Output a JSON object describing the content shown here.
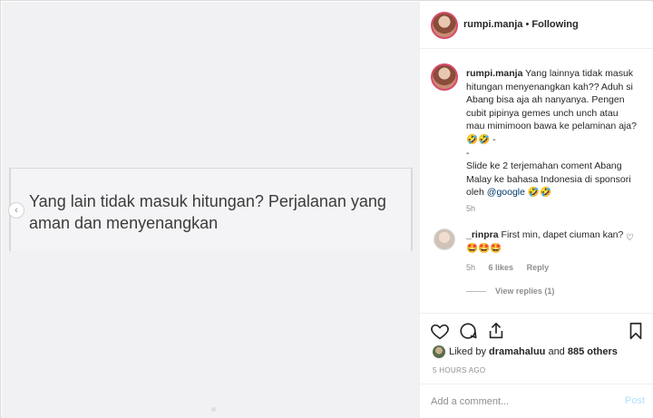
{
  "media": {
    "text": "Yang lain tidak masuk hitungan? Perjalanan yang aman dan menyenangkan",
    "prev_icon": "chevron-left-icon"
  },
  "header": {
    "username": "rumpi.manja",
    "separator": " • ",
    "follow_label": "Following"
  },
  "caption": {
    "username": "rumpi.manja",
    "text": "Yang lainnya tidak masuk hitungan menyenangkan kah?? Aduh si Abang bisa aja ah nanyanya. Pengen cubit pipinya gemes unch unch atau mau mimimoon bawa ke pelaminan aja? 🤣🤣 -\n-\nSlide ke 2 terjemahan coment Abang Malay ke bahasa Indonesia di sponsori oleh ",
    "mention": "@google",
    "text_end": " 🤣🤣",
    "time": "5h"
  },
  "comment": {
    "username": "_rinpra",
    "text": "First min, dapet ciuman kan?🤩🤩🤩",
    "time": "5h",
    "likes": "6 likes",
    "reply_label": "Reply",
    "view_replies": "View replies (1)"
  },
  "actions": {
    "icons": [
      "heart-icon",
      "comment-icon",
      "share-icon",
      "bookmark-icon"
    ],
    "liked_by_prefix": "Liked by ",
    "liked_by_user": "dramahaluu",
    "liked_by_and": " and ",
    "liked_by_others": "885 others",
    "time_ago": "5 HOURS AGO"
  },
  "add_comment": {
    "placeholder": "Add a comment...",
    "post_label": "Post"
  },
  "colors": {
    "accent": "#0095f6",
    "post_disabled": "#b2dffc",
    "story_ring": "#d84b6b"
  }
}
